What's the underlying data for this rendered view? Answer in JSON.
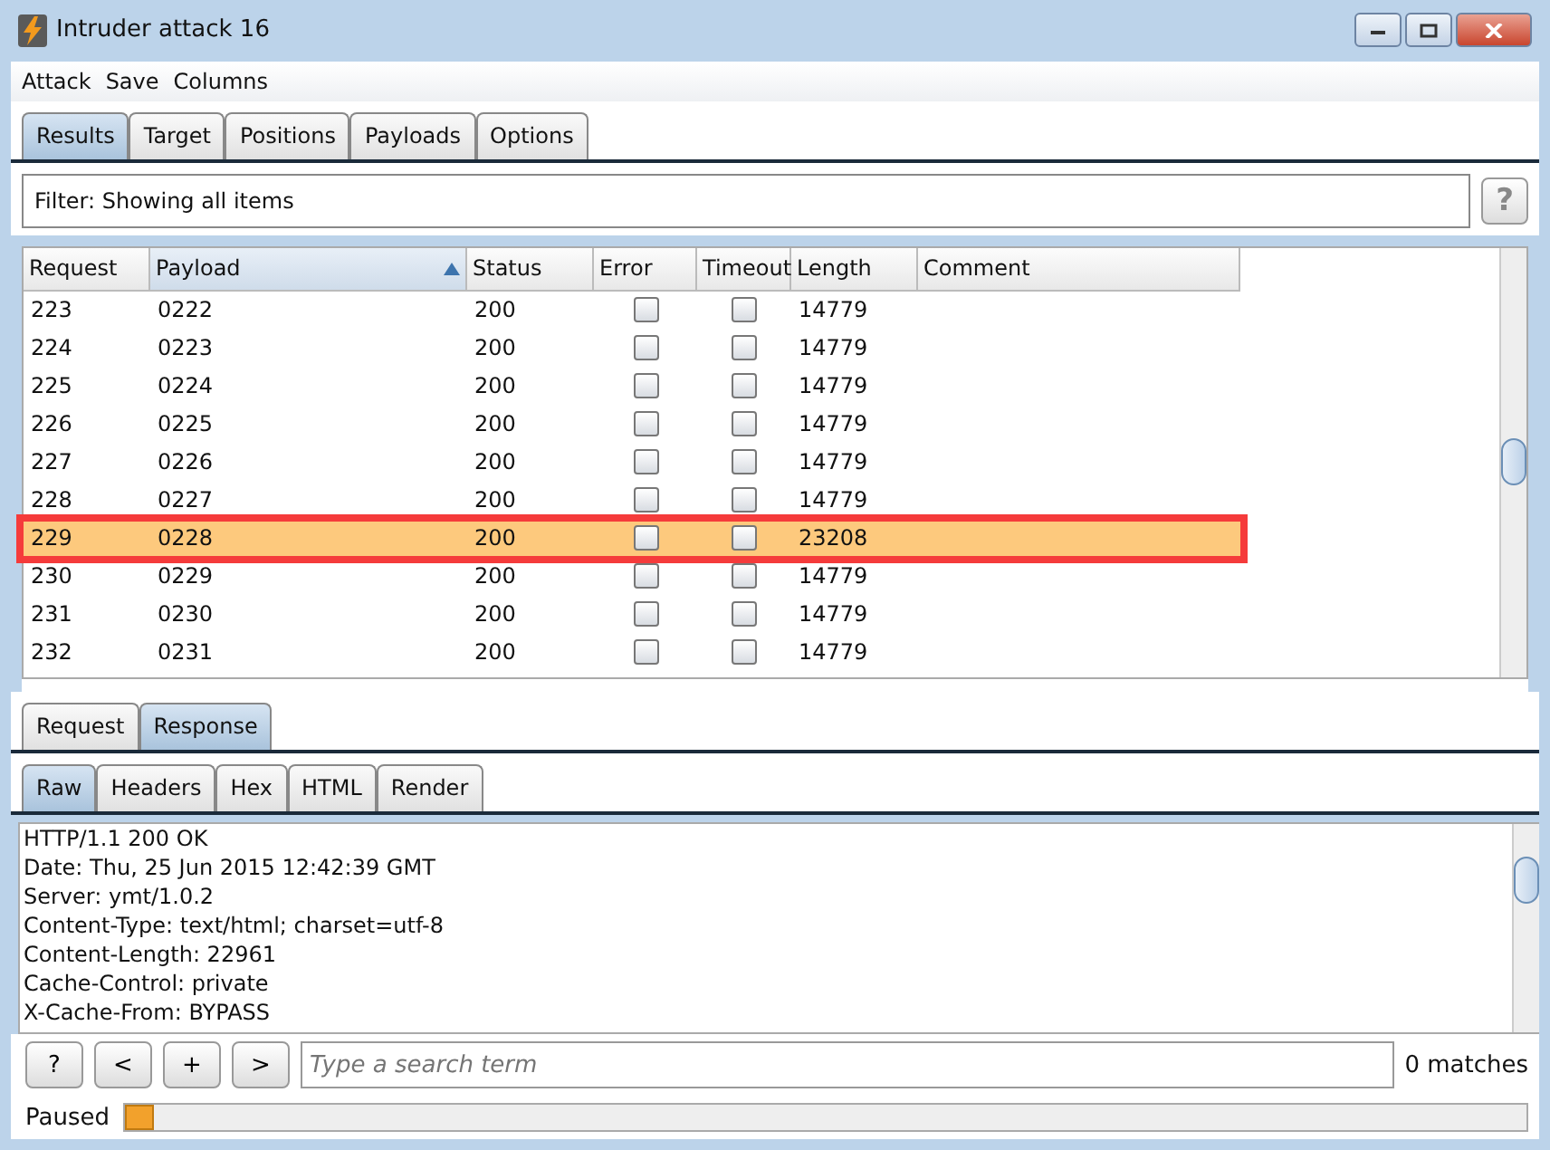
{
  "window": {
    "title": "Intruder attack 16"
  },
  "menu": [
    "Attack",
    "Save",
    "Columns"
  ],
  "tabs": [
    {
      "label": "Results",
      "selected": true
    },
    {
      "label": "Target",
      "selected": false
    },
    {
      "label": "Positions",
      "selected": false
    },
    {
      "label": "Payloads",
      "selected": false
    },
    {
      "label": "Options",
      "selected": false
    }
  ],
  "filter": {
    "text": "Filter: Showing all items",
    "help": "?"
  },
  "table": {
    "columns": [
      {
        "label": "Request",
        "sorted": false
      },
      {
        "label": "Payload",
        "sorted": true
      },
      {
        "label": "Status",
        "sorted": false
      },
      {
        "label": "Error",
        "sorted": false
      },
      {
        "label": "Timeout",
        "sorted": false
      },
      {
        "label": "Length",
        "sorted": false
      },
      {
        "label": "Comment",
        "sorted": false
      }
    ],
    "rows": [
      {
        "request": "223",
        "payload": "0222",
        "status": "200",
        "error": false,
        "timeout": false,
        "length": "14779",
        "selected": false
      },
      {
        "request": "224",
        "payload": "0223",
        "status": "200",
        "error": false,
        "timeout": false,
        "length": "14779",
        "selected": false
      },
      {
        "request": "225",
        "payload": "0224",
        "status": "200",
        "error": false,
        "timeout": false,
        "length": "14779",
        "selected": false
      },
      {
        "request": "226",
        "payload": "0225",
        "status": "200",
        "error": false,
        "timeout": false,
        "length": "14779",
        "selected": false
      },
      {
        "request": "227",
        "payload": "0226",
        "status": "200",
        "error": false,
        "timeout": false,
        "length": "14779",
        "selected": false
      },
      {
        "request": "228",
        "payload": "0227",
        "status": "200",
        "error": false,
        "timeout": false,
        "length": "14779",
        "selected": false
      },
      {
        "request": "229",
        "payload": "0228",
        "status": "200",
        "error": false,
        "timeout": false,
        "length": "23208",
        "selected": true
      },
      {
        "request": "230",
        "payload": "0229",
        "status": "200",
        "error": false,
        "timeout": false,
        "length": "14779",
        "selected": false
      },
      {
        "request": "231",
        "payload": "0230",
        "status": "200",
        "error": false,
        "timeout": false,
        "length": "14779",
        "selected": false
      },
      {
        "request": "232",
        "payload": "0231",
        "status": "200",
        "error": false,
        "timeout": false,
        "length": "14779",
        "selected": false
      }
    ]
  },
  "message_tabs": [
    {
      "label": "Request",
      "selected": false
    },
    {
      "label": "Response",
      "selected": true
    }
  ],
  "view_tabs": [
    {
      "label": "Raw",
      "selected": true
    },
    {
      "label": "Headers",
      "selected": false
    },
    {
      "label": "Hex",
      "selected": false
    },
    {
      "label": "HTML",
      "selected": false
    },
    {
      "label": "Render",
      "selected": false
    }
  ],
  "response_lines": [
    "HTTP/1.1 200 OK",
    "Date: Thu, 25 Jun 2015 12:42:39 GMT",
    "Server: ymt/1.0.2",
    "Content-Type: text/html; charset=utf-8",
    "Content-Length: 22961",
    "Cache-Control: private",
    "X-Cache-From: BYPASS"
  ],
  "search": {
    "buttons": [
      "?",
      "<",
      "+",
      ">"
    ],
    "placeholder": "Type a search term",
    "matches": "0 matches"
  },
  "status_bar": {
    "label": "Paused",
    "level": 0.02
  }
}
